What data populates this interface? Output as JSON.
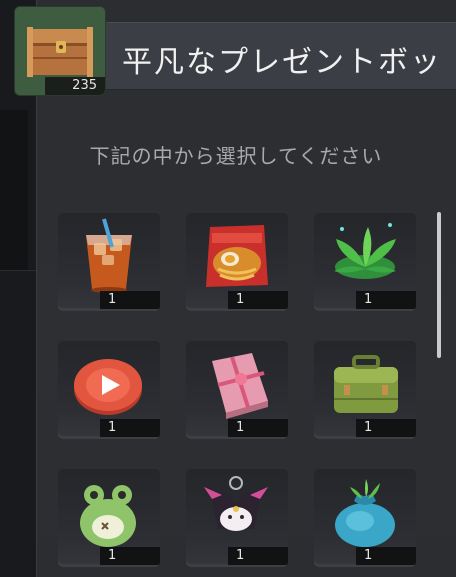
{
  "header": {
    "title": "平凡なプレゼントボッ",
    "chest_count": "235",
    "chest_icon": "treasure-chest-icon"
  },
  "instruction": "下記の中から選択してください",
  "items": [
    {
      "name": "iced-tea-icon",
      "qty": "1"
    },
    {
      "name": "ramen-cup-icon",
      "qty": "1"
    },
    {
      "name": "green-herb-icon",
      "qty": "1"
    },
    {
      "name": "red-play-token-icon",
      "qty": "1"
    },
    {
      "name": "pink-gift-book-icon",
      "qty": "1"
    },
    {
      "name": "green-suitcase-icon",
      "qty": "1"
    },
    {
      "name": "frog-plush-icon",
      "qty": "1"
    },
    {
      "name": "kuromi-keychain-icon",
      "qty": "1"
    },
    {
      "name": "blue-bag-icon",
      "qty": "1"
    }
  ],
  "colors": {
    "panel": "#2b2d31",
    "title_bar": "#3b3e44",
    "text": "#f1f1f1",
    "muted": "#a7a9ad"
  }
}
